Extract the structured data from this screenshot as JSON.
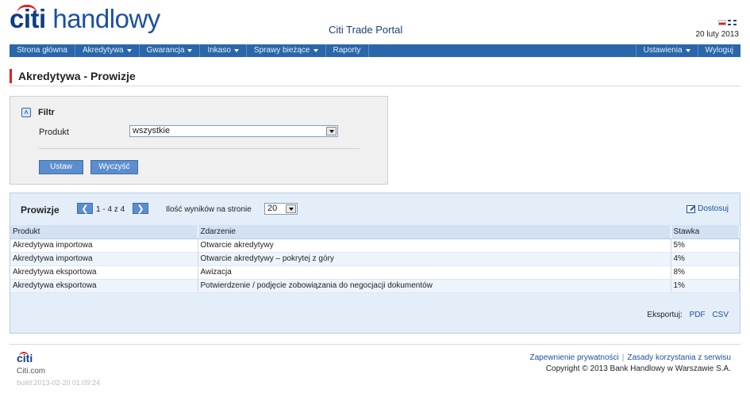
{
  "header": {
    "logo_citi": "citi",
    "logo_rest": " handlowy",
    "portal_title": "Citi Trade Portal",
    "date": "20 luty 2013"
  },
  "nav": {
    "items": [
      {
        "label": "Strona główna",
        "dropdown": false
      },
      {
        "label": "Akredytywa",
        "dropdown": true
      },
      {
        "label": "Gwarancja",
        "dropdown": true
      },
      {
        "label": "Inkaso",
        "dropdown": true
      },
      {
        "label": "Sprawy bieżące",
        "dropdown": true
      },
      {
        "label": "Raporty",
        "dropdown": false
      }
    ],
    "right_items": [
      {
        "label": "Ustawienia",
        "dropdown": true
      },
      {
        "label": "Wyloguj",
        "dropdown": false
      }
    ]
  },
  "page": {
    "title": "Akredytywa - Prowizje"
  },
  "filter": {
    "title": "Filtr",
    "product_label": "Produkt",
    "product_value": "wszystkie",
    "apply_label": "Ustaw",
    "clear_label": "Wyczyść"
  },
  "results": {
    "title": "Prowizje",
    "pager_text": "1 - 4 z 4",
    "per_page_label": "Ilość wyników na stronie",
    "per_page_value": "20",
    "customize_label": "Dostosuj",
    "columns": [
      "Produkt",
      "Zdarzenie",
      "Stawka"
    ],
    "rows": [
      [
        "Akredytywa importowa",
        "Otwarcie akredytywy",
        "5%"
      ],
      [
        "Akredytywa importowa",
        "Otwarcie akredytywy – pokrytej z góry",
        "4%"
      ],
      [
        "Akredytywa eksportowa",
        "Awizacja",
        "8%"
      ],
      [
        "Akredytywa eksportowa",
        "Potwierdzenie / podjęcie zobowiązania do negocjacji dokumentów",
        "1%"
      ]
    ],
    "export_label": "Eksportuj:",
    "export_pdf": "PDF",
    "export_csv": "CSV"
  },
  "footer": {
    "logo": "citi",
    "site": "Citi.com",
    "build": "build:2013-02-20 01:09:24",
    "privacy_link": "Zapewnienie prywatności",
    "terms_link": "Zasady korzystania z serwisu",
    "link_separator": "|",
    "copyright": "Copyright © 2013 Bank Handlowy w Warszawie S.A."
  },
  "colors": {
    "brand_blue": "#0f3c87",
    "nav_blue": "#2a66a9",
    "accent_red": "#e0201b",
    "panel_blue": "#e3eef9"
  },
  "icons": {
    "filter_toggle": "chevron-up-icon",
    "pager_prev": "chevron-left-icon",
    "pager_next": "chevron-right-icon",
    "customize": "edit-icon",
    "select_arrow": "chevron-down-icon"
  }
}
